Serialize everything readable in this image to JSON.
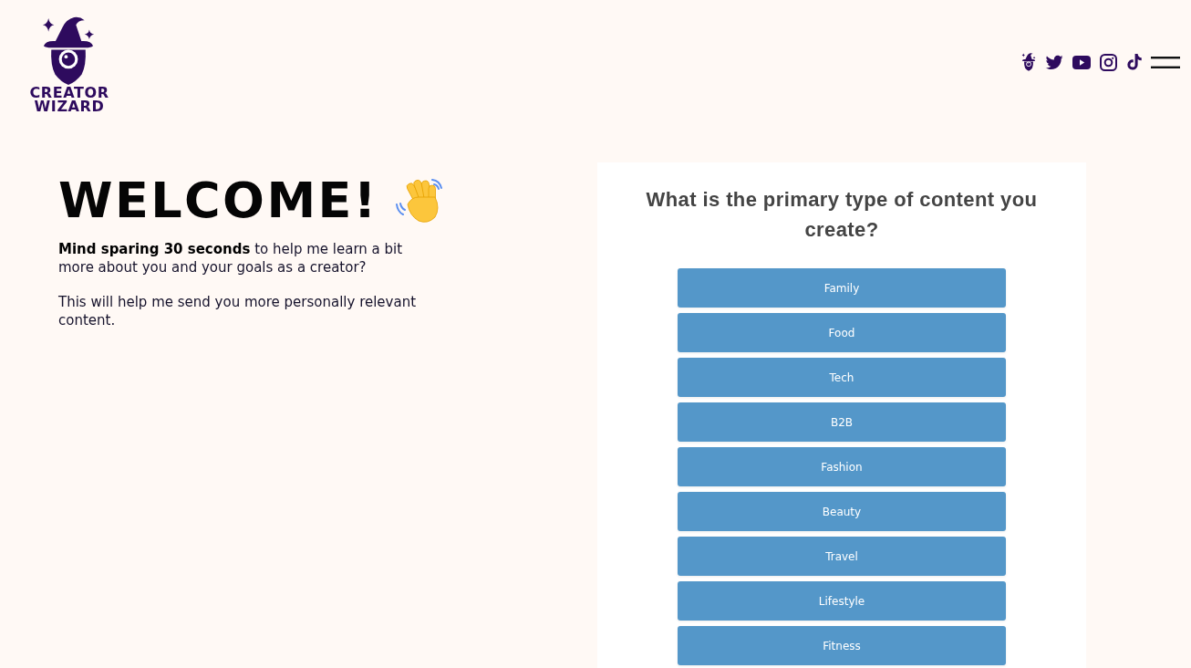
{
  "header": {
    "brand": [
      "CREATOR",
      "WIZARD"
    ]
  },
  "intro": {
    "title": "WELCOME!",
    "paragraphs": [
      "**Mind sparing 30 seconds** to help me learn a bit more about you and your goals as a creator?",
      "This will help me send you more personally relevant content."
    ]
  },
  "survey": {
    "question": "What is the primary type of content you create?",
    "options": [
      {
        "label": "Family",
        "selected": false
      },
      {
        "label": "Food",
        "selected": false
      },
      {
        "label": "Tech",
        "selected": false
      },
      {
        "label": "B2B",
        "selected": false
      },
      {
        "label": "Fashion",
        "selected": false
      },
      {
        "label": "Beauty",
        "selected": false
      },
      {
        "label": "Travel",
        "selected": false
      },
      {
        "label": "Lifestyle",
        "selected": false
      },
      {
        "label": "Fitness",
        "selected": false
      }
    ]
  }
}
